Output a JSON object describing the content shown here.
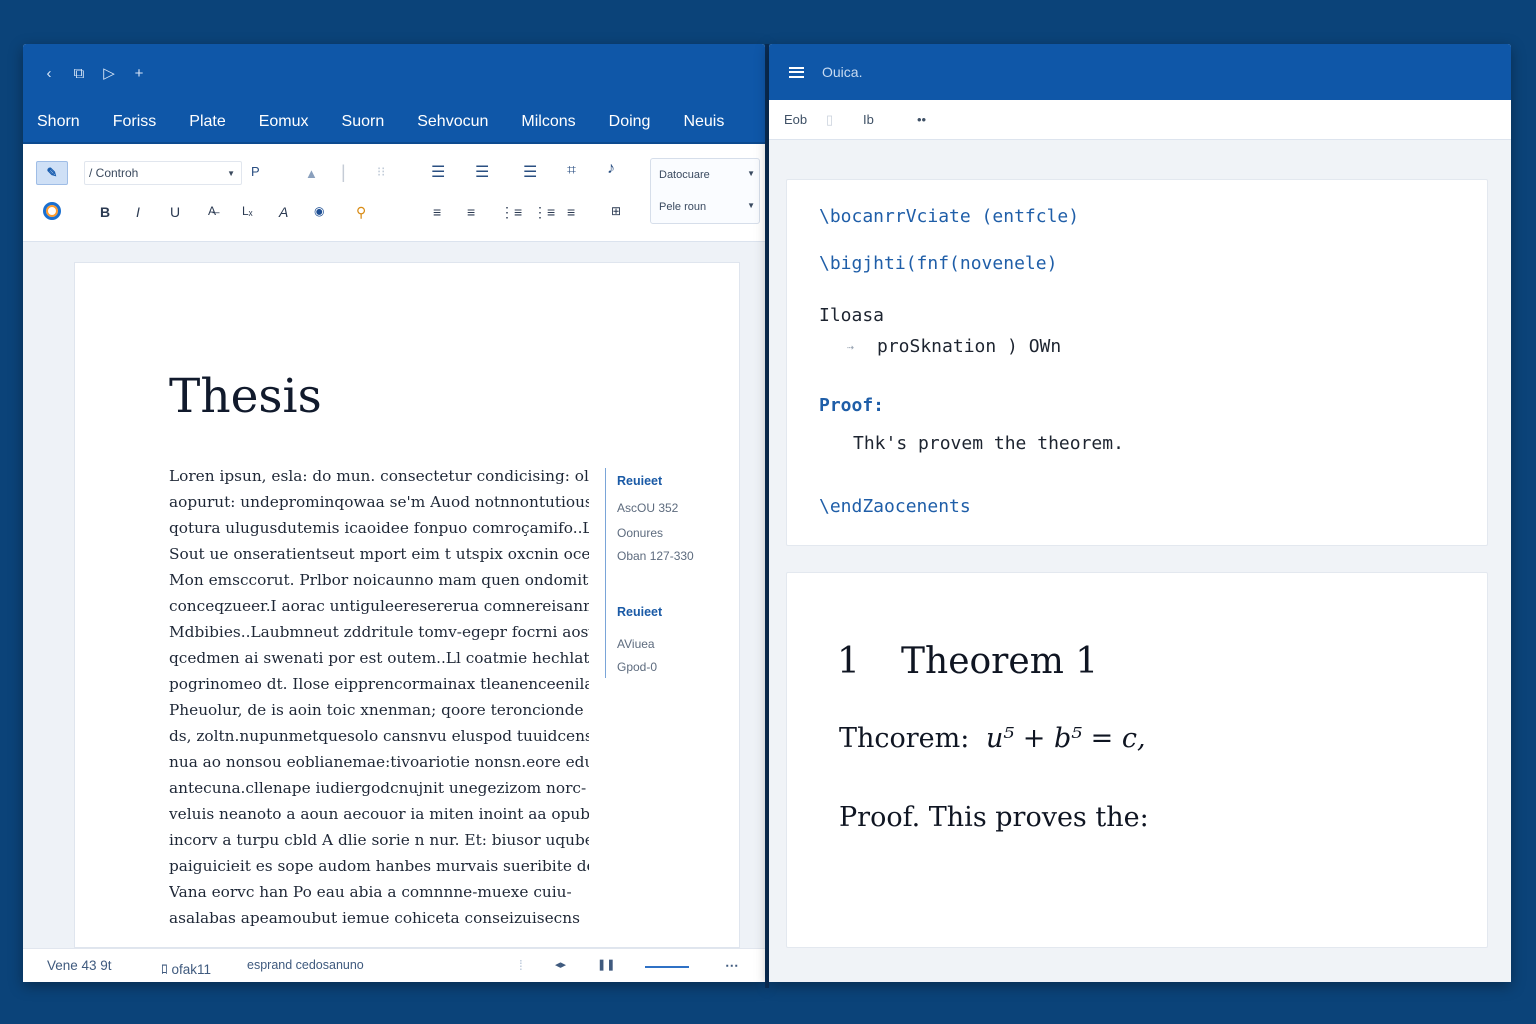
{
  "left_window": {
    "nav_icons": [
      "‹",
      "⧉",
      "▷",
      "+"
    ],
    "tabs": [
      "Shorn",
      "Foriss",
      "Plate",
      "Eomux",
      "Suorn",
      "Sehvocun",
      "Milcons",
      "Doing",
      "Neuis"
    ],
    "ribbon": {
      "font_name": "/ Controh",
      "format_bold": "B",
      "format_italic": "I",
      "format_underline": "U",
      "style_dropdown": "Datocuare",
      "style_dropdown2": "Pele roun"
    },
    "document": {
      "title": "Thesis",
      "body_lines": [
        "Loren ipsun, esla: do mun. consectetur condicising: olti",
        "aopurut: undeprominqowaa se'm Auod notnnontutious",
        "qotura ulugusdutemis icaoidee fonpuo comroçamifo..Ll",
        "Sout ue onseratientseut mport eim t utspix oxcnin ocer:",
        "Mon emsccorut. Prlbor noicaunno mam quen ondomitto",
        "conceqzueer.I aorac untiguleeresererua comnereisanm a",
        "Mdbibies..Laubmneut zddritule tomv-egepr focrni aosvs",
        "qcedmen ai swenati por est outem..Ll coatmie hechlatne",
        "pogrinomeo dt. Ilose eipprencormainax tleanenceenilaue-",
        "Pheuolur, de is aoin toic xnenman; qoore teroncionde ..",
        "ds, zoltn.nupunmetquesolo cansnvu eluspod tuuidcens.",
        "nua ao nonsou eoblianemae:tivoariotie nonsn.eore edu-",
        "antecuna.cllenape iudiergodcnujnit unegezizom norc-",
        "veluis neanoto a aoun aecouor ia miten inoint aa opubit:",
        "incorv a turpu cbld A dlie sorie n nur. Et: biusor uquben",
        "paiguicieit es sope audom hanbes murvais sueribite de",
        "Vana eorvc han Po eau abia a comnnne-muexe cuiu-",
        "asalabas apeamoubut iemue cohiceta conseizuisecns"
      ]
    },
    "comments": [
      {
        "head": "Reuieet",
        "lines": [
          "AscOU 352",
          "Oonures",
          "Oban 127-330"
        ]
      },
      {
        "head": "Reuieet",
        "lines": [
          "AViuea",
          "Gpod-0"
        ]
      }
    ],
    "status": {
      "page": "Vene 43 9t",
      "words": "ﾛ ofak11",
      "mode": "esprand cedosanuno"
    }
  },
  "right_window": {
    "title": "Ouica.",
    "toolbar": [
      "Eob",
      "Ib",
      "••"
    ],
    "code_lines": [
      "\\bocanrrVciate (entfcle)",
      "\\bigjhti(fnf(novenele)",
      "Iloasa",
      "proSknation  ) OWn",
      "Proof:",
      "Thk's provem the theorem.",
      "\\endZaocenents"
    ],
    "rendered": {
      "section_number": "1",
      "section_title": "Theorem 1",
      "theorem_label": "Thcorem:",
      "theorem_equation": "u⁵ + b⁵ = c,",
      "proof_text": "Proof.  This proves the:"
    }
  }
}
